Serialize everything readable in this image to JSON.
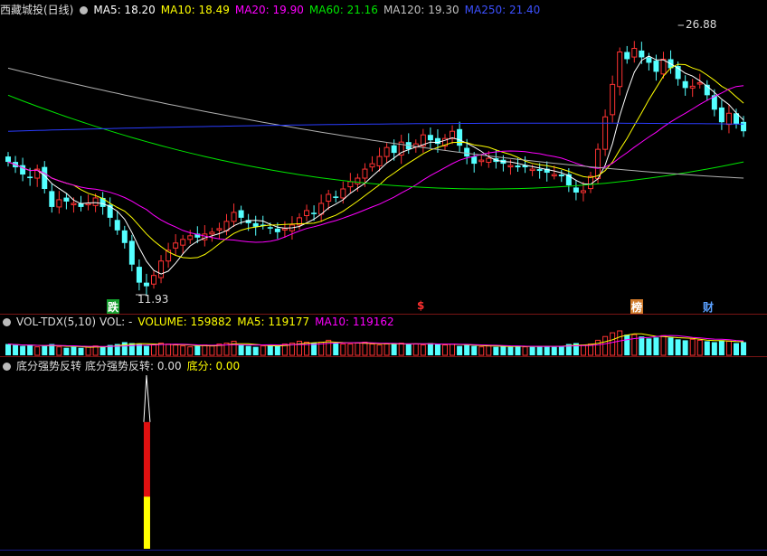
{
  "main_header": {
    "title": "西藏城投(日线)",
    "ma5": "MA5: 18.20",
    "ma10": "MA10: 18.49",
    "ma20": "MA20: 19.90",
    "ma60": "MA60: 21.16",
    "ma120": "MA120: 19.30",
    "ma250": "MA250: 21.40"
  },
  "price_labels": {
    "high": "26.88",
    "low": "11.93"
  },
  "markers": {
    "die": "跌",
    "dollar": "$",
    "bang": "榜",
    "cai": "财"
  },
  "vol_header": {
    "name": "VOL-TDX(5,10)",
    "vol": "VOL: -",
    "volume": "VOLUME: 159882",
    "ma5": "MA5: 119177",
    "ma10": "MA10: 119162"
  },
  "ind_header": {
    "name": "底分强势反转",
    "value": "底分强势反转: 0.00",
    "difen": "底分: 0.00"
  },
  "colors": {
    "up": "#ff3232",
    "down": "#54ffff",
    "ma5": "#ffffff",
    "ma10": "#ffff00",
    "ma20": "#ff00ff",
    "ma60": "#00e600",
    "ma120": "#b0b0b0",
    "ma250": "#2a3cff",
    "divider": "#7a1414"
  },
  "chart_data": {
    "type": "candlestick",
    "price_range": [
      11.93,
      26.88
    ],
    "closes": [
      19.3,
      19.0,
      18.6,
      18.4,
      18.9,
      17.8,
      16.8,
      17.2,
      17.1,
      17.0,
      16.8,
      17.0,
      17.3,
      16.8,
      16.2,
      15.5,
      14.8,
      13.6,
      12.6,
      12.4,
      13.0,
      13.8,
      14.4,
      14.8,
      15.0,
      15.2,
      15.1,
      15.3,
      15.4,
      15.6,
      16.0,
      16.5,
      16.2,
      15.9,
      15.7,
      15.8,
      15.6,
      15.4,
      15.6,
      15.8,
      16.2,
      16.6,
      16.4,
      17.0,
      17.5,
      17.3,
      17.8,
      18.2,
      18.4,
      18.9,
      19.2,
      19.6,
      20.1,
      19.8,
      20.4,
      20.0,
      20.3,
      20.8,
      20.5,
      20.3,
      20.6,
      21.0,
      20.2,
      19.6,
      19.2,
      19.4,
      19.5,
      19.3,
      19.2,
      19.1,
      19.0,
      19.0,
      18.9,
      18.8,
      18.7,
      18.6,
      18.5,
      18.0,
      17.6,
      17.7,
      18.5,
      20.0,
      21.8,
      23.6,
      25.4,
      25.0,
      25.6,
      25.1,
      24.8,
      24.3,
      25.0,
      24.5,
      23.9,
      23.4,
      23.5,
      23.7,
      23.0,
      22.2,
      21.5,
      22.0,
      21.4,
      21.0
    ],
    "volumes": [
      12,
      11,
      10,
      11,
      9,
      10,
      12,
      9,
      8,
      9,
      8,
      9,
      10,
      9,
      11,
      12,
      14,
      13,
      12,
      10,
      11,
      13,
      12,
      11,
      10,
      9,
      10,
      11,
      10,
      12,
      13,
      15,
      11,
      10,
      9,
      10,
      11,
      10,
      12,
      13,
      15,
      14,
      13,
      14,
      16,
      13,
      12,
      12,
      13,
      14,
      12,
      11,
      12,
      12,
      13,
      12,
      12,
      11,
      13,
      12,
      11,
      12,
      10,
      11,
      10,
      9,
      10,
      9,
      10,
      9,
      10,
      9,
      9,
      10,
      10,
      9,
      10,
      12,
      13,
      11,
      12,
      16,
      20,
      24,
      26,
      22,
      22,
      20,
      18,
      19,
      21,
      19,
      17,
      16,
      17,
      16,
      15,
      14,
      16,
      15,
      13,
      14
    ]
  },
  "indicator": {
    "spike_index": 19,
    "red_value": 0.73,
    "yellow_value": 0.3
  }
}
